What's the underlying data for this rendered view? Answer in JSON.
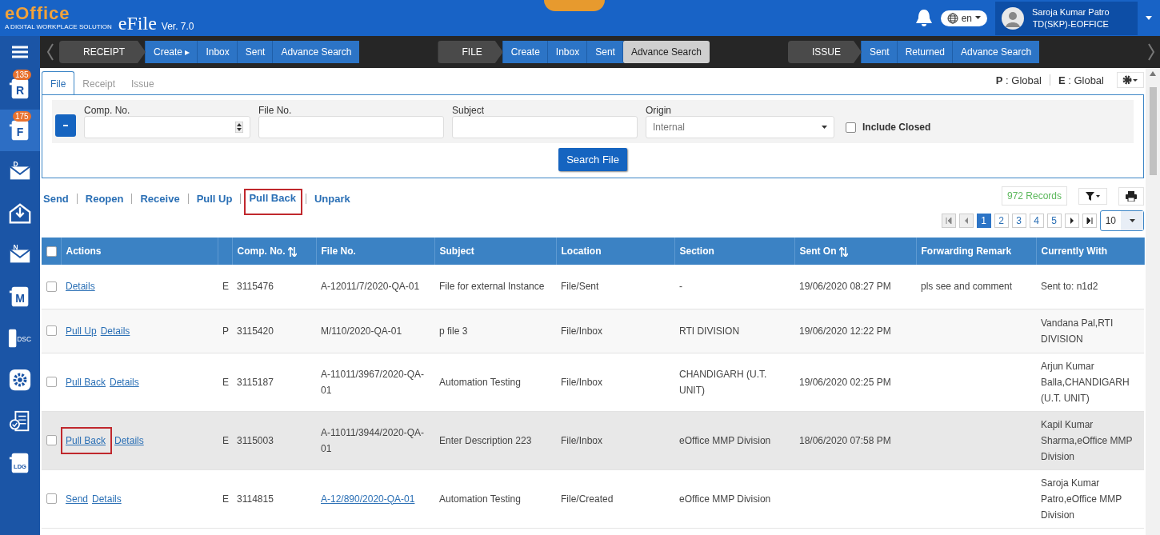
{
  "header": {
    "logo": "eOffice",
    "tagline": "A DIGITAL WORKPLACE SOLUTION",
    "app": "eFile",
    "version": "Ver. 7.0",
    "language": "en",
    "user_name": "Saroja Kumar Patro",
    "user_role": "TD(SKP)-EOFFICE"
  },
  "nav": [
    {
      "title": "RECEIPT",
      "items": [
        {
          "label": "Create ▸",
          "selected": false
        },
        {
          "label": "Inbox",
          "selected": false
        },
        {
          "label": "Sent",
          "selected": false
        },
        {
          "label": "Advance Search",
          "selected": false
        }
      ]
    },
    {
      "title": "FILE",
      "items": [
        {
          "label": "Create",
          "selected": false
        },
        {
          "label": "Inbox",
          "selected": false
        },
        {
          "label": "Sent",
          "selected": false
        },
        {
          "label": "Advance Search",
          "selected": true
        }
      ]
    },
    {
      "title": "ISSUE",
      "items": [
        {
          "label": "Sent",
          "selected": false
        },
        {
          "label": "Returned",
          "selected": false
        },
        {
          "label": "Advance Search",
          "selected": false
        }
      ]
    }
  ],
  "sidebar": [
    {
      "kind": "doc",
      "label": "R",
      "badge": "135",
      "selected": false
    },
    {
      "kind": "doc",
      "label": "F",
      "badge": "175",
      "selected": true
    },
    {
      "kind": "mail",
      "label": "D",
      "selected": false
    },
    {
      "kind": "inbox",
      "selected": false
    },
    {
      "kind": "mail",
      "label": "N",
      "selected": false
    },
    {
      "kind": "doc",
      "label": "M",
      "selected": false
    },
    {
      "kind": "dsc",
      "label": "DSC",
      "selected": false
    },
    {
      "kind": "gear",
      "selected": false
    },
    {
      "kind": "check",
      "selected": false
    },
    {
      "kind": "doc",
      "label": "LDG",
      "selected": false
    }
  ],
  "tabs": [
    {
      "label": "File",
      "selected": true
    },
    {
      "label": "Receipt",
      "selected": false
    },
    {
      "label": "Issue",
      "selected": false
    }
  ],
  "scope": [
    "**P** : Global",
    "**E** : Global"
  ],
  "search": {
    "fields": [
      {
        "label": "Comp. No.",
        "kind": "number"
      },
      {
        "label": "File No.",
        "kind": "text"
      },
      {
        "label": "Subject",
        "kind": "text"
      },
      {
        "label": "Origin",
        "kind": "select",
        "value": "Internal"
      }
    ],
    "include_closed": {
      "label": "Include Closed",
      "checked": false
    },
    "button": "Search File"
  },
  "actions": [
    {
      "label": "Send",
      "highlighted": false
    },
    {
      "label": "Reopen",
      "highlighted": false
    },
    {
      "label": "Receive",
      "highlighted": false
    },
    {
      "label": "Pull Up",
      "highlighted": false
    },
    {
      "label": "Pull Back",
      "highlighted": true
    },
    {
      "label": "Unpark",
      "highlighted": false
    }
  ],
  "records": "972 Records",
  "pagination": {
    "pages": [
      {
        "label": "1",
        "selected": true
      },
      {
        "label": "2",
        "selected": false
      },
      {
        "label": "3",
        "selected": false
      },
      {
        "label": "4",
        "selected": false
      },
      {
        "label": "5",
        "selected": false
      }
    ],
    "page_size": "10"
  },
  "table": {
    "all_checked": false,
    "columns": [
      {
        "label": "Actions",
        "sortable": false
      },
      {
        "label": "Comp. No.",
        "sortable": true
      },
      {
        "label": "File No.",
        "sortable": false
      },
      {
        "label": "Subject",
        "sortable": false
      },
      {
        "label": "Location",
        "sortable": false
      },
      {
        "label": "Section",
        "sortable": false
      },
      {
        "label": "Sent On",
        "sortable": true
      },
      {
        "label": "Forwarding Remark",
        "sortable": false
      },
      {
        "label": "Currently With",
        "sortable": false
      }
    ],
    "rows": [
      {
        "checked": false,
        "hovered": false,
        "actions": [
          {
            "label": "Details",
            "highlighted": false
          }
        ],
        "type": "E",
        "comp_no": "3115476",
        "file_no": "A-12011/7/2020-QA-01",
        "file_link": false,
        "subject": "File for external Instance",
        "location": "File/Sent",
        "section": "-",
        "sent_on": "19/06/2020 08:27 PM",
        "remark": "pls see and comment",
        "currently_with": "Sent to: n1d2"
      },
      {
        "checked": false,
        "hovered": false,
        "actions": [
          {
            "label": "Pull Up",
            "highlighted": false
          },
          {
            "label": "Details",
            "highlighted": false
          }
        ],
        "type": "P",
        "comp_no": "3115420",
        "file_no": "M/110/2020-QA-01",
        "file_link": false,
        "subject": "p file 3",
        "location": "File/Inbox",
        "section": "RTI DIVISION",
        "sent_on": "19/06/2020 12:22 PM",
        "currently_with": "Vandana Pal,RTI DIVISION"
      },
      {
        "checked": false,
        "hovered": false,
        "actions": [
          {
            "label": "Pull Back",
            "highlighted": false
          },
          {
            "label": "Details",
            "highlighted": false
          }
        ],
        "type": "E",
        "comp_no": "3115187",
        "file_no": "A-11011/3967/2020-QA-01",
        "file_link": false,
        "subject": "Automation Testing",
        "location": "File/Inbox",
        "section": "CHANDIGARH (U.T. UNIT)",
        "sent_on": "19/06/2020 02:25 PM",
        "currently_with": "Arjun Kumar Balla,CHANDIGARH (U.T. UNIT)"
      },
      {
        "checked": false,
        "hovered": true,
        "actions": [
          {
            "label": "Pull Back",
            "highlighted": true
          },
          {
            "label": "Details",
            "highlighted": false
          }
        ],
        "type": "E",
        "comp_no": "3115003",
        "file_no": "A-11011/3944/2020-QA-01",
        "file_link": false,
        "subject": "Enter Description 223",
        "location": "File/Inbox",
        "section": "eOffice MMP Division",
        "sent_on": "18/06/2020 07:58 PM",
        "currently_with": "Kapil Kumar Sharma,eOffice MMP Division"
      },
      {
        "checked": false,
        "hovered": false,
        "actions": [
          {
            "label": "Send",
            "highlighted": false
          },
          {
            "label": "Details",
            "highlighted": false
          }
        ],
        "type": "E",
        "comp_no": "3114815",
        "file_no": "A-12/890/2020-QA-01",
        "file_link": true,
        "subject": "Automation Testing",
        "location": "File/Created",
        "section": "eOffice MMP Division",
        "currently_with": "Saroja Kumar Patro,eOffice MMP Division"
      }
    ]
  }
}
